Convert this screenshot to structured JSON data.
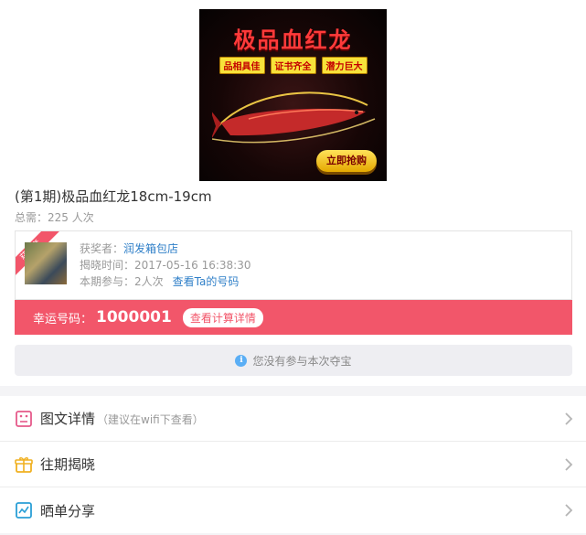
{
  "banner": {
    "title": "极品血红龙",
    "tags": [
      "品相具佳",
      "证书齐全",
      "潜力巨大"
    ],
    "buy_label": "立即抢购"
  },
  "product": {
    "title": "(第1期)极品血红龙18cm-19cm",
    "total_need": "总需：225 人次"
  },
  "winner": {
    "ribbon": "获奖者",
    "rows": [
      {
        "label": "获奖者：",
        "value": "润发箱包店"
      },
      {
        "label": "揭晓时间：",
        "value": "2017-05-16 16:38:30"
      },
      {
        "label": "本期参与：",
        "value": "2人次"
      }
    ],
    "view_code": "查看Ta的号码"
  },
  "lucky": {
    "label": "幸运号码：",
    "number": "1000001",
    "calc_button": "查看计算详情"
  },
  "notice": {
    "icon": "info-icon",
    "text": "您没有参与本次夺宝"
  },
  "menu": [
    {
      "label": "图文详情",
      "note": "（建议在wifi下查看）",
      "icon": "detail-icon",
      "color": "#e55a8a"
    },
    {
      "label": "往期揭晓",
      "note": "",
      "icon": "gift-icon",
      "color": "#f0b020"
    },
    {
      "label": "晒单分享",
      "note": "",
      "icon": "chart-icon",
      "color": "#2a9fd6"
    }
  ],
  "colors": {
    "accent": "#f2566a",
    "link": "#2f7fc8"
  }
}
